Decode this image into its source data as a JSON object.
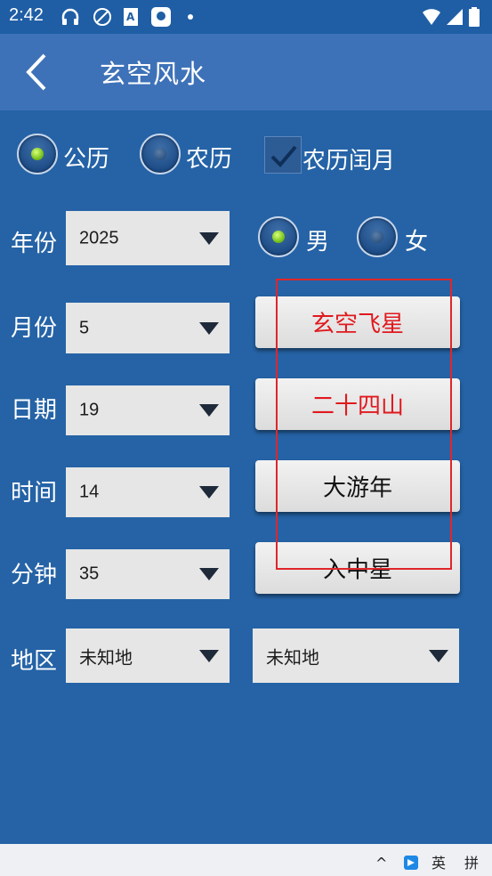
{
  "status_bar": {
    "time": "2:42",
    "icons": [
      "headset-icon",
      "no-data-icon",
      "font-icon",
      "app-badge-icon",
      "dot-icon",
      "wifi-icon",
      "signal-icon",
      "battery-icon"
    ]
  },
  "app_bar": {
    "title": "玄空风水",
    "back_icon": "chevron-left-icon"
  },
  "calendar": {
    "gregorian": {
      "label": "公历",
      "selected": true
    },
    "lunar": {
      "label": "农历",
      "selected": false
    },
    "leap_month": {
      "label": "农历闰月",
      "checked": true
    }
  },
  "fields": {
    "year": {
      "label": "年份",
      "value": "2025"
    },
    "month": {
      "label": "月份",
      "value": "5"
    },
    "day": {
      "label": "日期",
      "value": "19"
    },
    "hour": {
      "label": "时间",
      "value": "14"
    },
    "minute": {
      "label": "分钟",
      "value": "35"
    },
    "region": {
      "label": "地区",
      "value": "未知地",
      "value2": "未知地"
    }
  },
  "gender": {
    "male": {
      "label": "男",
      "selected": true
    },
    "female": {
      "label": "女",
      "selected": false
    }
  },
  "actions": {
    "flying_star": {
      "label": "玄空飞星",
      "color": "#e0191e"
    },
    "mountains": {
      "label": "二十四山",
      "color": "#e0191e"
    },
    "year_cycle": {
      "label": "大游年",
      "color": "#111111"
    },
    "center_star": {
      "label": "入中星",
      "color": "#111111"
    }
  },
  "annotation_color": "#e0262a",
  "nav_bar": {
    "caret": "^",
    "keyboard_icon": "keyboard-icon",
    "lang": "英",
    "mode": "拼"
  }
}
